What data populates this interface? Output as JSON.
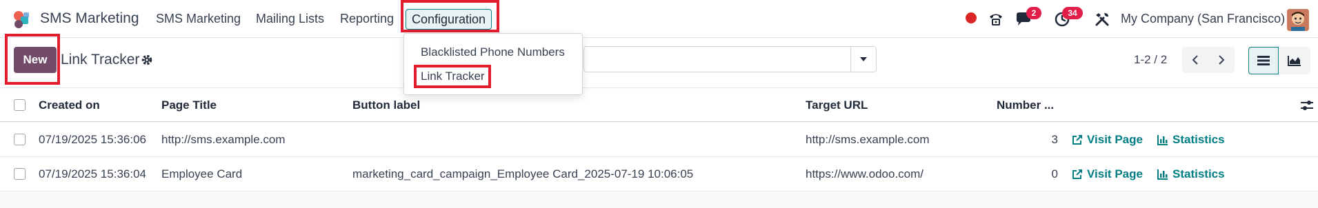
{
  "topbar": {
    "app_name": "SMS Marketing",
    "menus": [
      "SMS Marketing",
      "Mailing Lists",
      "Reporting",
      "Configuration"
    ],
    "messages_count": "2",
    "activities_count": "34",
    "company": "My Company (San Francisco)"
  },
  "control": {
    "new_label": "New",
    "breadcrumb": "Link Tracker",
    "pager": "1-2 / 2"
  },
  "dropdown": {
    "items": [
      "Blacklisted Phone Numbers",
      "Link Tracker"
    ]
  },
  "table": {
    "columns": [
      "Created on",
      "Page Title",
      "Button label",
      "Target URL",
      "Number ..."
    ],
    "rows": [
      {
        "created_on": "07/19/2025 15:36:06",
        "page_title": "http://sms.example.com",
        "button_label": "",
        "target_url": "http://sms.example.com",
        "number": "3",
        "visit": "Visit Page",
        "stats": "Statistics"
      },
      {
        "created_on": "07/19/2025 15:36:04",
        "page_title": "Employee Card",
        "button_label": "marketing_card_campaign_Employee Card_2025-07-19 10:06:05",
        "target_url": "https://www.odoo.com/",
        "number": "0",
        "visit": "Visit Page",
        "stats": "Statistics"
      }
    ]
  },
  "colors": {
    "brand": "#714b67",
    "accent": "#017e84",
    "highlight": "#e11d2e",
    "badge": "#e11d48"
  }
}
